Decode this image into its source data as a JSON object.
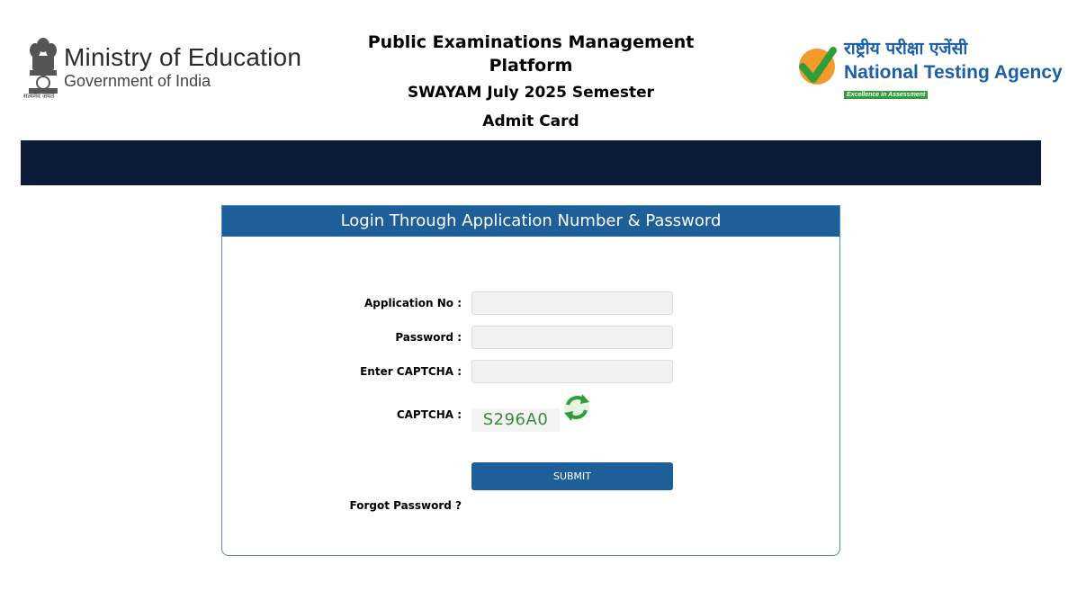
{
  "header": {
    "ministry_title": "Ministry of Education",
    "ministry_subtitle": "Government of India",
    "ministry_motto": "सत्यमेव जयते",
    "platform_title": "Public Examinations Management Platform",
    "semester": "SWAYAM July 2025 Semester",
    "document": "Admit Card",
    "agency_hindi": "राष्ट्रीय परीक्षा एजेंसी",
    "agency_english": "National Testing Agency",
    "agency_tagline": "Excellence in Assessment"
  },
  "login": {
    "heading": "Login Through Application Number & Password",
    "application_label": "Application No :",
    "application_value": "",
    "password_label": "Password :",
    "password_value": "",
    "captcha_input_label": "Enter CAPTCHA :",
    "captcha_input_value": "",
    "captcha_label": "CAPTCHA :",
    "captcha_text": "S296A0",
    "submit_label": "SUBMIT",
    "forgot_label": "Forgot Password ?"
  },
  "icons": {
    "ministry_logo": "national-emblem-icon",
    "agency_logo": "nta-check-icon",
    "refresh": "refresh-icon"
  },
  "colors": {
    "band": "#0d1b3b",
    "panel_header": "#1f5f99",
    "agency_blue": "#1a5fa8",
    "agency_green": "#2e9d3a"
  }
}
